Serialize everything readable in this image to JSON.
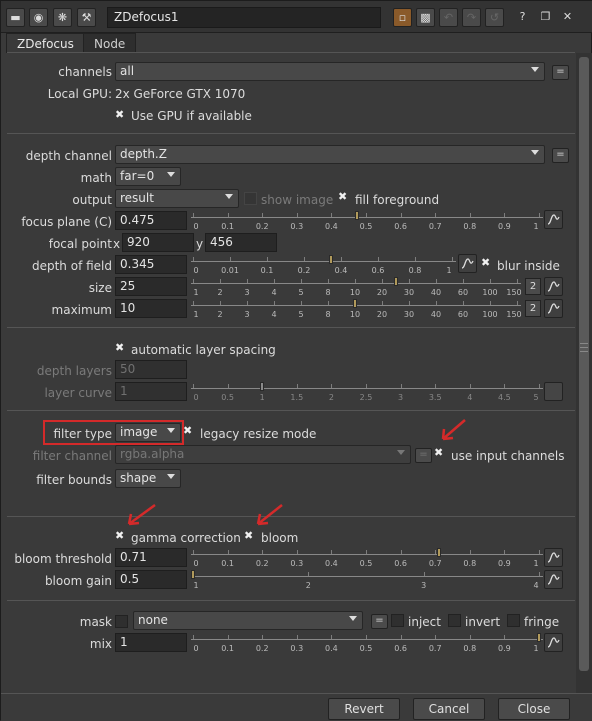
{
  "node_name": "ZDefocus1",
  "toolbar": {
    "help": "?",
    "float": "❐",
    "close": "✕"
  },
  "tabs": [
    "ZDefocus",
    "Node"
  ],
  "general": {
    "channels_label": "channels",
    "channels_value": "all",
    "local_gpu_label": "Local GPU:",
    "local_gpu_value": "2x GeForce GTX 1070",
    "use_gpu_label": "Use GPU if available"
  },
  "depth": {
    "depth_channel_label": "depth channel",
    "depth_channel_value": "depth.Z",
    "math_label": "math",
    "math_value": "far=0",
    "output_label": "output",
    "output_value": "result",
    "show_image_label": "show image",
    "fill_foreground_label": "fill foreground",
    "focus_plane_label": "focus plane (C)",
    "focus_plane_value": "0.475",
    "focal_point_label": "focal point",
    "focal_x_label": "x",
    "focal_x_value": "920",
    "focal_y_label": "y",
    "focal_y_value": "456",
    "depth_of_field_label": "depth of field",
    "depth_of_field_value": "0.345",
    "blur_inside_label": "blur inside",
    "size_label": "size",
    "size_value": "25",
    "maximum_label": "maximum",
    "maximum_value": "10",
    "dim_count": "2"
  },
  "layers": {
    "auto_spacing_label": "automatic layer spacing",
    "depth_layers_label": "depth layers",
    "depth_layers_value": "50",
    "layer_curve_label": "layer curve",
    "layer_curve_value": "1"
  },
  "filter": {
    "filter_type_label": "filter type",
    "filter_type_value": "image",
    "legacy_resize_label": "legacy resize mode",
    "filter_channel_label": "filter channel",
    "filter_channel_value": "rgba.alpha",
    "use_input_channels_label": "use input channels",
    "filter_bounds_label": "filter bounds",
    "filter_bounds_value": "shape"
  },
  "bloom": {
    "gamma_label": "gamma correction",
    "bloom_label": "bloom",
    "threshold_label": "bloom threshold",
    "threshold_value": "0.71",
    "gain_label": "bloom gain",
    "gain_value": "0.5"
  },
  "mask": {
    "mask_label": "mask",
    "mask_value": "none",
    "inject_label": "inject",
    "invert_label": "invert",
    "fringe_label": "fringe",
    "mix_label": "mix",
    "mix_value": "1"
  },
  "buttons": {
    "revert": "Revert",
    "cancel": "Cancel",
    "close": "Close"
  },
  "sliders": {
    "focus_plane": {
      "ticks": [
        "0",
        "0.1",
        "0.2",
        "0.3",
        "0.4",
        "0.5",
        "0.6",
        "0.7",
        "0.8",
        "0.9",
        "1"
      ],
      "handle": 0.475
    },
    "depth_of_field": {
      "ticks": [
        "0",
        "0.01",
        "0.1",
        "0.2",
        "0.4",
        "0.6",
        "0.8",
        "1"
      ],
      "handle": 0.345
    },
    "size": {
      "ticks": [
        "1",
        "2",
        "3",
        "4",
        "5",
        "8",
        "10",
        "20",
        "30",
        "40",
        "60",
        "100",
        "150"
      ],
      "handle": 25
    },
    "maximum": {
      "ticks": [
        "1",
        "2",
        "3",
        "4",
        "5",
        "8",
        "10",
        "20",
        "30",
        "40",
        "60",
        "100",
        "150"
      ],
      "handle": 10
    },
    "layer_curve": {
      "ticks": [
        "0",
        "0.5",
        "1",
        "1.5",
        "2",
        "2.5",
        "3",
        "3.5",
        "4",
        "4.5",
        "5"
      ],
      "handle": 1
    },
    "bloom_threshold": {
      "ticks": [
        "0",
        "0.1",
        "0.2",
        "0.3",
        "0.4",
        "0.5",
        "0.6",
        "0.7",
        "0.8",
        "0.9",
        "1"
      ],
      "handle": 0.71
    },
    "bloom_gain": {
      "ticks": [
        "1",
        "2",
        "3",
        "4"
      ],
      "handle": 0.5
    },
    "mix": {
      "ticks": [
        "0",
        "0.1",
        "0.2",
        "0.3",
        "0.4",
        "0.5",
        "0.6",
        "0.7",
        "0.8",
        "0.9",
        "1"
      ],
      "handle": 1
    }
  },
  "colors": {
    "annotation": "#d42a2a",
    "handle": "#b19a5b",
    "background": "#3a3a3a"
  }
}
